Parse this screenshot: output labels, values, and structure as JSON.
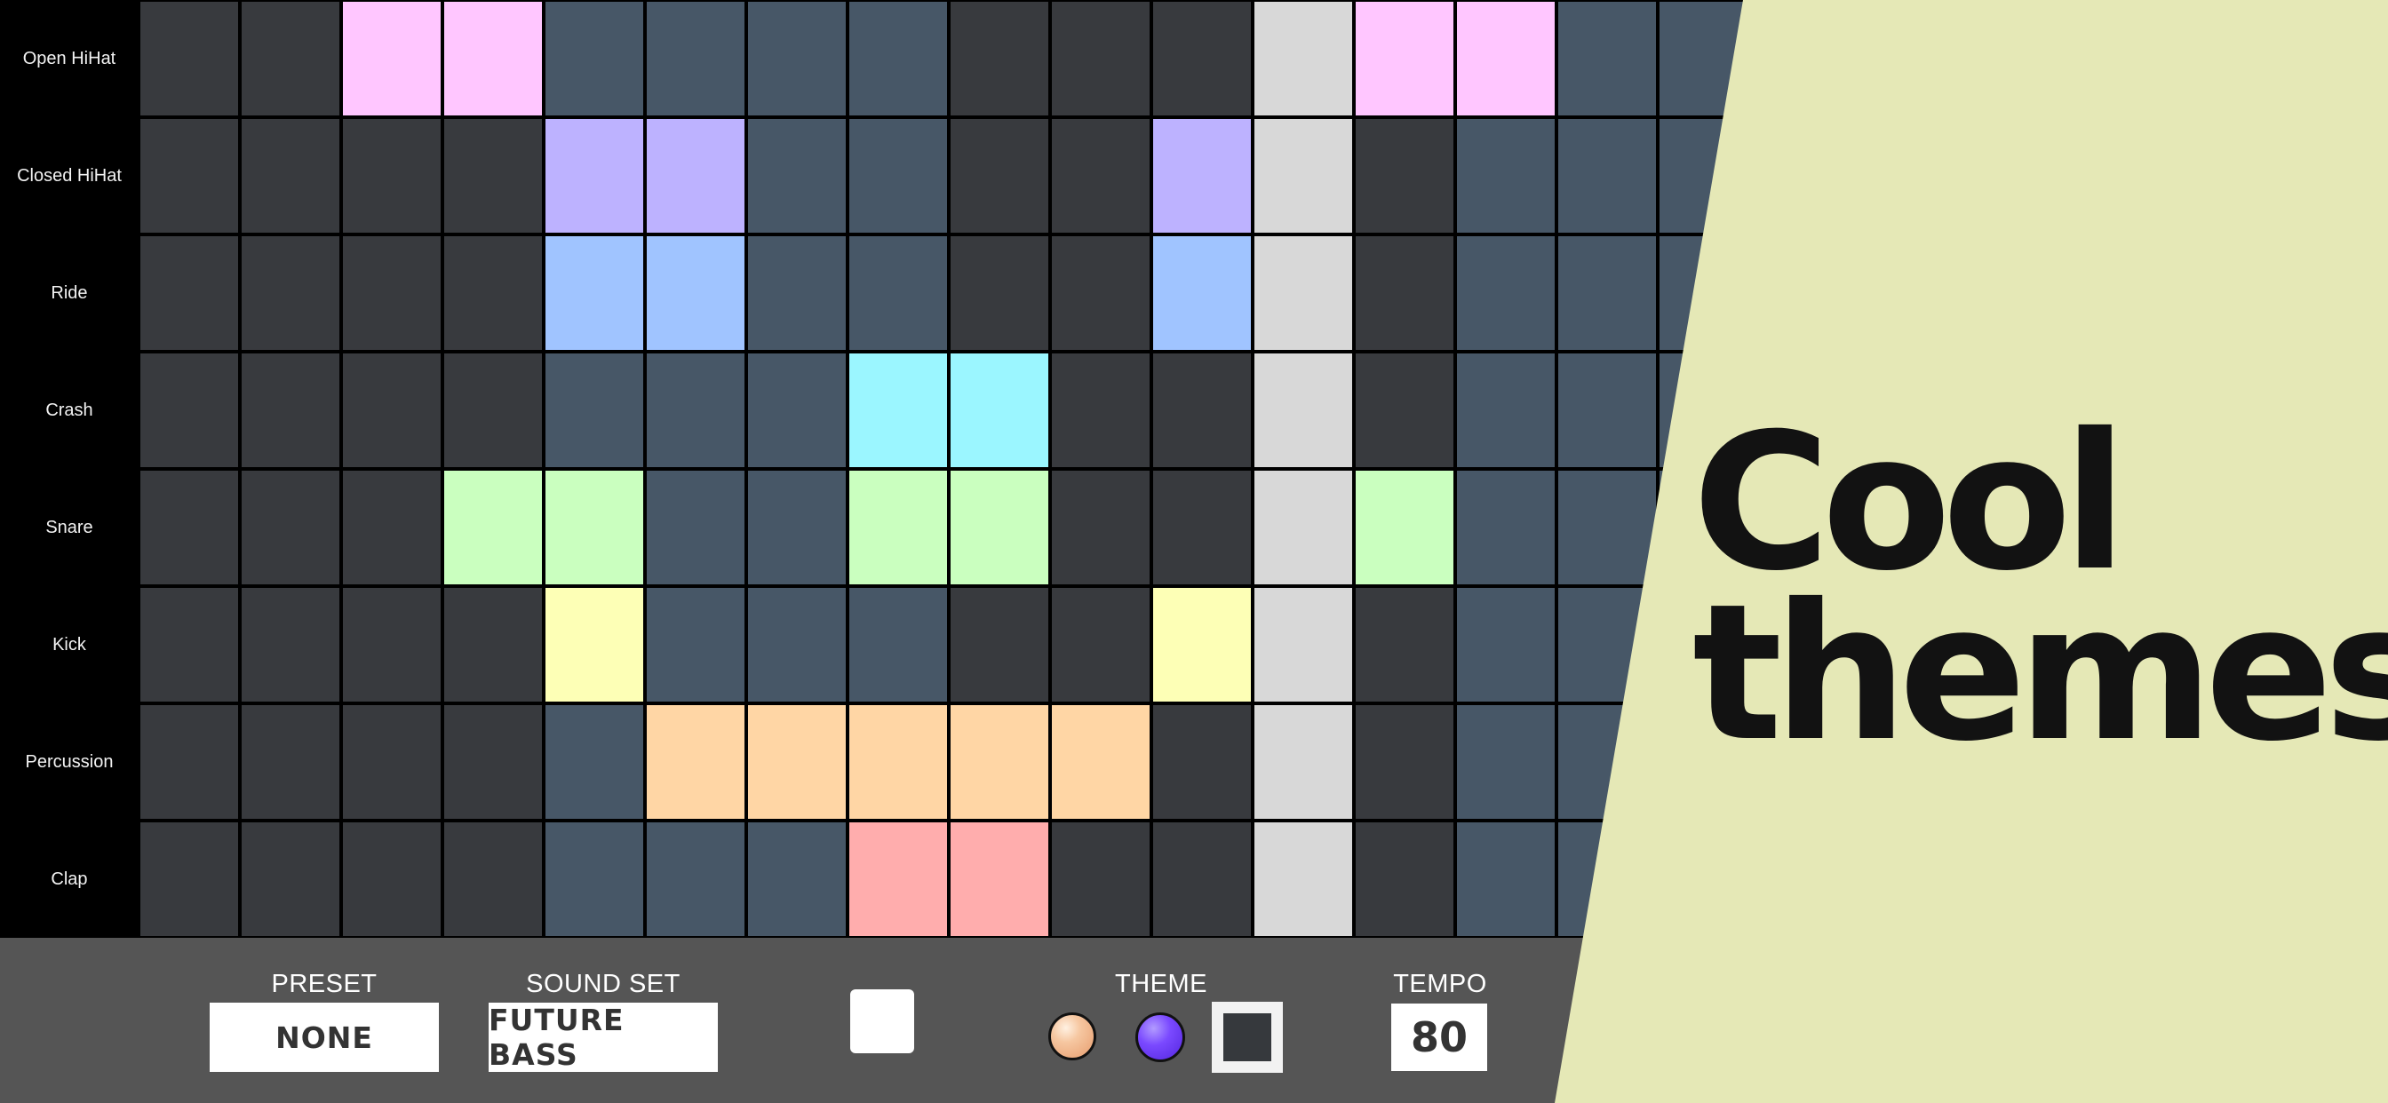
{
  "instruments": [
    "Open HiHat",
    "Closed HiHat",
    "Ride",
    "Crash",
    "Snare",
    "Kick",
    "Percussion",
    "Clap"
  ],
  "colors": {
    "dark": "#383a3e",
    "slate": "#475767",
    "playhead": "#d8d8d8",
    "open_hihat": "#ffc6ff",
    "closed_hihat": "#bdb2ff",
    "ride": "#a0c4ff",
    "crash": "#9bf6ff",
    "snare": "#caffbf",
    "kick": "#fdffb6",
    "percussion": "#ffd6a5",
    "clap": "#ffadad",
    "promo_background": "#e5e8b6",
    "control_bar": "#555555"
  },
  "grid": {
    "playhead_step": 11,
    "active": [
      [
        2,
        3,
        12,
        13
      ],
      [
        4,
        5,
        10
      ],
      [
        4,
        5,
        10
      ],
      [
        7,
        8
      ],
      [
        3,
        4,
        7,
        8,
        12
      ],
      [
        4,
        10
      ],
      [
        5,
        6,
        7,
        8,
        9
      ],
      [
        7,
        8
      ]
    ]
  },
  "controls": {
    "preset_label": "PRESET",
    "preset_value": "NONE",
    "sound_set_label": "SOUND SET",
    "sound_set_value": "FUTURE BASS",
    "theme_label": "THEME",
    "tempo_label": "TEMPO",
    "tempo_value": "80"
  },
  "promo": {
    "line1": "Cool",
    "line2": "themes"
  }
}
